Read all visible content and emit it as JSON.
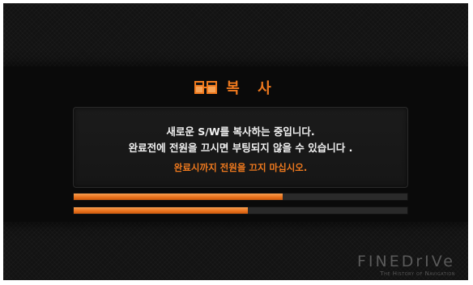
{
  "dialog": {
    "title": "복 사",
    "icon": "copy-icon",
    "messages": [
      "새로운 S/W를 복사하는 중입니다.",
      "완료전에 전원을 끄시면 부팅되지 않을 수 있습니다 .",
      "완료시까지 전원을 끄지 마십시오."
    ]
  },
  "progress": {
    "bar1_fraction": 0.625,
    "bar2_fraction": 0.522
  },
  "brand": {
    "logo": "FINEDrIVe",
    "tagline": "The History of Navigation"
  },
  "colors": {
    "accent": "#f07a1e",
    "background": "#131313",
    "text": "#f2f2f2"
  }
}
